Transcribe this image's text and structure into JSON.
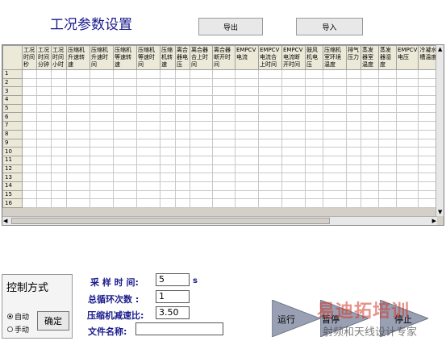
{
  "title": "工况参数设置",
  "buttons": {
    "export": "导出",
    "import": "导入",
    "confirm": "确定",
    "run": "运行",
    "pause": "暂停",
    "stop": "停止"
  },
  "grid": {
    "columns": [
      "工况时间秒",
      "工况时间分钟",
      "工况时间小时",
      "压缩机升速转速",
      "压缩机升速时间",
      "压缩机等速转速",
      "压缩机等速时间",
      "压缩机转速",
      "离合器电压",
      "离合器合上时间",
      "离合器断开时间",
      "EMPCV电流",
      "EMPCV电流合上时间",
      "EMPCV电流断开时间",
      "鼓风机电压",
      "压缩机室环境温度",
      "排气压力",
      "蒸发器室温度",
      "蒸发器湿度",
      "EMPCV电压",
      "冷凝水槽温度"
    ],
    "rows": [
      "1",
      "2",
      "3",
      "4",
      "5",
      "6",
      "7",
      "8",
      "9",
      "10",
      "11",
      "12",
      "13",
      "14",
      "15",
      "16"
    ]
  },
  "control": {
    "heading": "控制方式",
    "options": [
      "自动",
      "手动"
    ],
    "selected": "自动"
  },
  "params": {
    "sample_label": "采 样 时 间:",
    "sample_value": "5",
    "sample_unit": "s",
    "loop_label": "总循环次数 :",
    "loop_value": "1",
    "decel_label": "压缩机减速比:",
    "decel_value": "3.50",
    "file_label": "文件名称:",
    "file_value": ""
  },
  "watermark": {
    "line1": "易迪拓培训",
    "line2": "射频和天线设计专家"
  }
}
